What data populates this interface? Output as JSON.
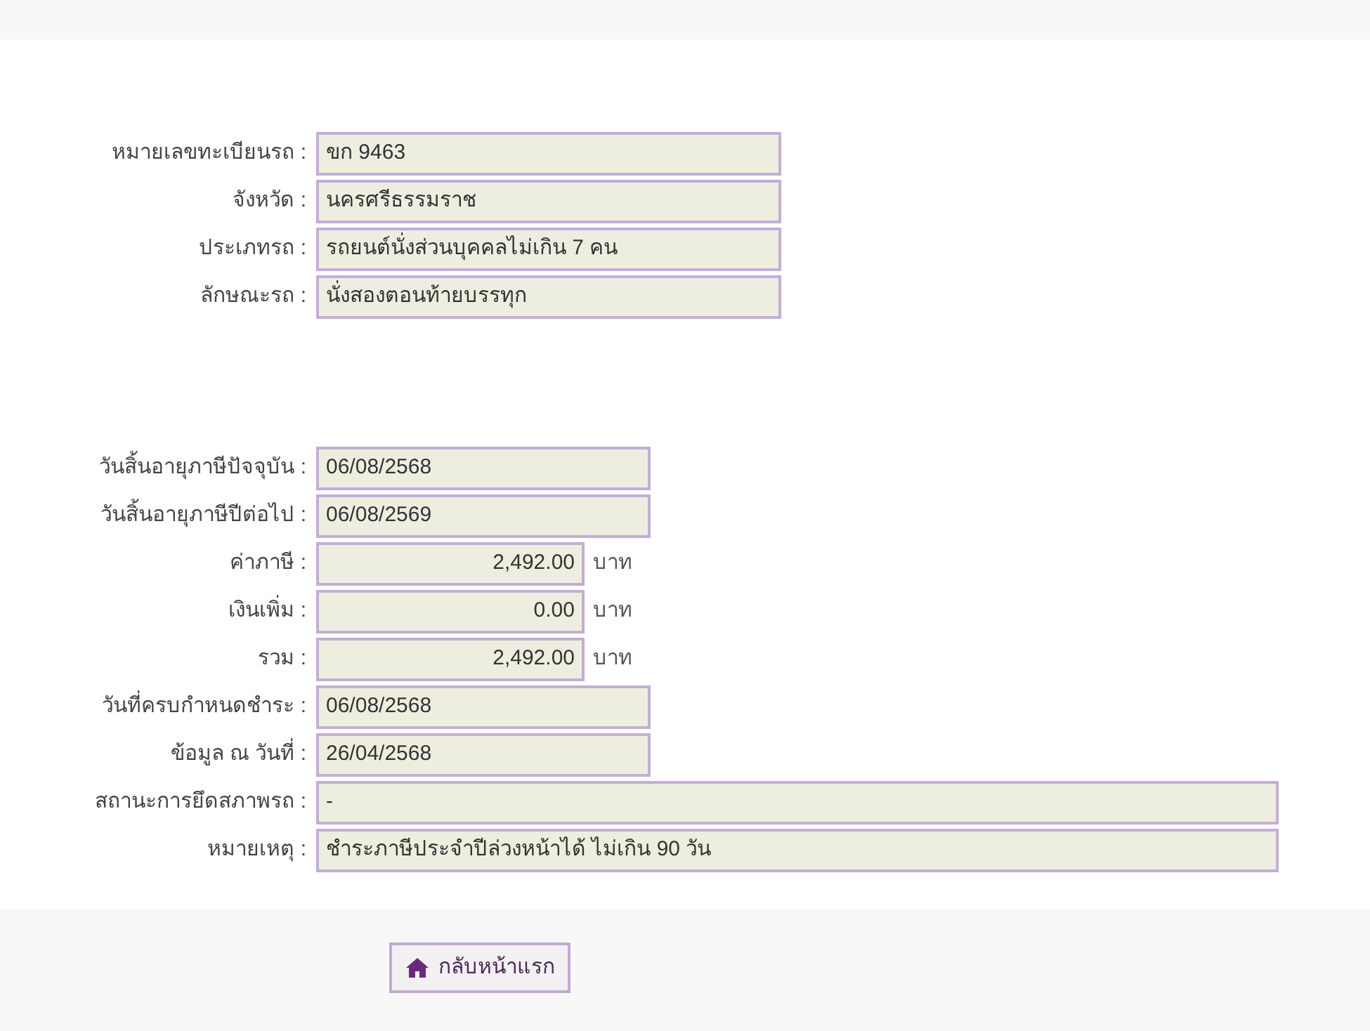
{
  "vehicle": [
    {
      "label": "หมายเลขทะเบียนรถ :",
      "value": "ขก 9463",
      "kind": "text"
    },
    {
      "label": "จังหวัด :",
      "value": "นครศรีธรรมราช",
      "kind": "text"
    },
    {
      "label": "ประเภทรถ :",
      "value": "รถยนต์นั่งส่วนบุคคลไม่เกิน 7 คน",
      "kind": "text"
    },
    {
      "label": "ลักษณะรถ :",
      "value": "นั่งสองตอนท้ายบรรทุก",
      "kind": "text"
    }
  ],
  "tax": [
    {
      "label": "วันสิ้นอายุภาษีปัจจุบัน :",
      "value": "06/08/2568",
      "kind": "date"
    },
    {
      "label": "วันสิ้นอายุภาษีปีต่อไป :",
      "value": "06/08/2569",
      "kind": "date"
    },
    {
      "label": "ค่าภาษี :",
      "value": "2,492.00",
      "kind": "money",
      "unit": "บาท"
    },
    {
      "label": "เงินเพิ่ม :",
      "value": "0.00",
      "kind": "money",
      "unit": "บาท"
    },
    {
      "label": "รวม :",
      "value": "2,492.00",
      "kind": "money",
      "unit": "บาท"
    },
    {
      "label": "วันที่ครบกำหนดชำระ :",
      "value": "06/08/2568",
      "kind": "date"
    },
    {
      "label": "ข้อมูล ณ วันที่ :",
      "value": "26/04/2568",
      "kind": "date"
    },
    {
      "label": "สถานะการยึดสภาพรถ :",
      "value": "-",
      "kind": "wide"
    },
    {
      "label": "หมายเหตุ :",
      "value": "ชำระภาษีประจำปีล่วงหน้าได้ ไม่เกิน 90 วัน",
      "kind": "wide"
    }
  ],
  "home_button": {
    "label": "กลับหน้าแรก"
  }
}
